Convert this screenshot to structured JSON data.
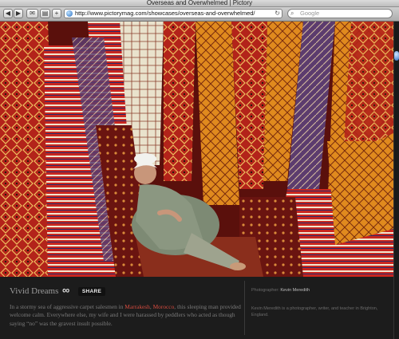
{
  "window": {
    "title": "Overseas and Overwhelmed | Pictory"
  },
  "toolbar": {
    "back_icon": "back-arrow-icon",
    "forward_icon": "forward-arrow-icon",
    "url": "http://www.pictorymag.com/showcases/overseas-and-overwhelmed/",
    "search_placeholder": "Google"
  },
  "caption": {
    "title": "Vivid Dreams",
    "infinity": "∞",
    "share_label": "SHARE",
    "desc_pre": "In a stormy sea of aggressive carpet salesmen in ",
    "desc_city": "Marrakesh",
    "desc_sep": ", ",
    "desc_country": "Morocco",
    "desc_post": ", this sleeping man provided welcome calm. Everywhere else, my wife and I were harassed by peddlers who acted as though saying “no” was the gravest insult possible.",
    "photographer_label": "Photographer: ",
    "photographer_name": "Kevin Meredith",
    "bio": "Kevin Meredith is a photographer, writer, and teacher in Brighton, England.",
    "highlight_color": "#d44b3f"
  }
}
